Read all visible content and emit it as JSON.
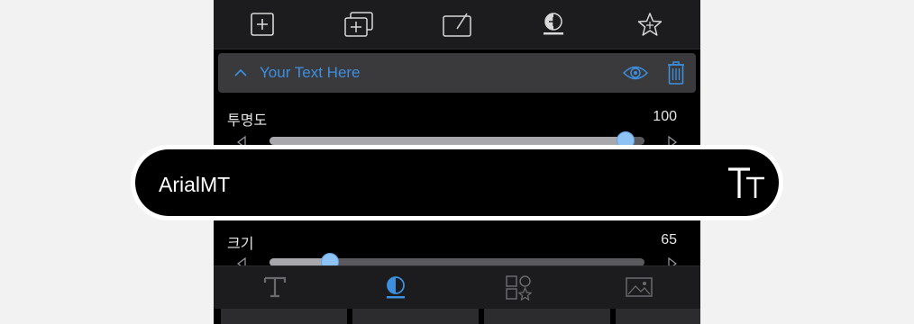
{
  "toolbar": {
    "icons": [
      "add-layer-icon",
      "duplicate-layer-icon",
      "edit-layer-icon",
      "color-drop-icon",
      "favorite-star-icon"
    ]
  },
  "layer": {
    "title": "Your Text Here",
    "collapse_icon": "chevron-up-icon",
    "visibility_icon": "eye-icon",
    "delete_icon": "trash-icon"
  },
  "opacity": {
    "label": "투명도",
    "value": "100",
    "fraction": 0.95
  },
  "font": {
    "name": "ArialMT",
    "icon": "text-size-icon"
  },
  "size": {
    "label": "크기",
    "value": "65",
    "fraction": 0.16
  },
  "tabs": {
    "items": [
      "text-tab-icon",
      "color-tab-icon",
      "shapes-tab-icon",
      "image-tab-icon"
    ],
    "active_index": 1
  },
  "colors": {
    "accent": "#3d8fe0",
    "thumb": "#8fc2f4",
    "background": "#000000",
    "panel": "#1c1c1e"
  }
}
